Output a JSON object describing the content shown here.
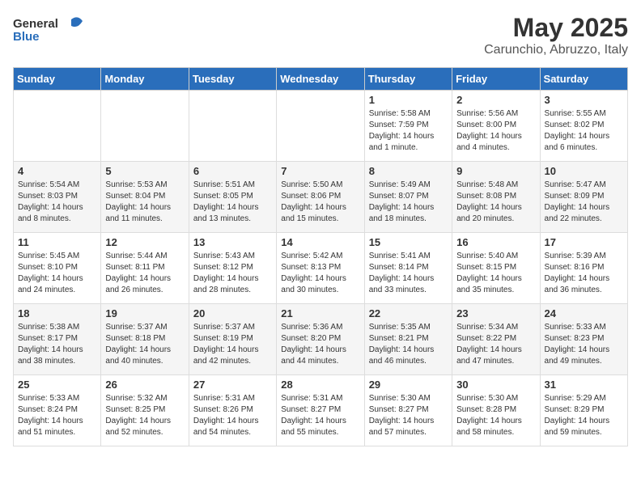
{
  "header": {
    "logo_general": "General",
    "logo_blue": "Blue",
    "month_year": "May 2025",
    "location": "Carunchio, Abruzzo, Italy"
  },
  "weekdays": [
    "Sunday",
    "Monday",
    "Tuesday",
    "Wednesday",
    "Thursday",
    "Friday",
    "Saturday"
  ],
  "weeks": [
    [
      {
        "day": "",
        "sunrise": "",
        "sunset": "",
        "daylight": ""
      },
      {
        "day": "",
        "sunrise": "",
        "sunset": "",
        "daylight": ""
      },
      {
        "day": "",
        "sunrise": "",
        "sunset": "",
        "daylight": ""
      },
      {
        "day": "",
        "sunrise": "",
        "sunset": "",
        "daylight": ""
      },
      {
        "day": "1",
        "sunrise": "Sunrise: 5:58 AM",
        "sunset": "Sunset: 7:59 PM",
        "daylight": "Daylight: 14 hours and 1 minute."
      },
      {
        "day": "2",
        "sunrise": "Sunrise: 5:56 AM",
        "sunset": "Sunset: 8:00 PM",
        "daylight": "Daylight: 14 hours and 4 minutes."
      },
      {
        "day": "3",
        "sunrise": "Sunrise: 5:55 AM",
        "sunset": "Sunset: 8:02 PM",
        "daylight": "Daylight: 14 hours and 6 minutes."
      }
    ],
    [
      {
        "day": "4",
        "sunrise": "Sunrise: 5:54 AM",
        "sunset": "Sunset: 8:03 PM",
        "daylight": "Daylight: 14 hours and 8 minutes."
      },
      {
        "day": "5",
        "sunrise": "Sunrise: 5:53 AM",
        "sunset": "Sunset: 8:04 PM",
        "daylight": "Daylight: 14 hours and 11 minutes."
      },
      {
        "day": "6",
        "sunrise": "Sunrise: 5:51 AM",
        "sunset": "Sunset: 8:05 PM",
        "daylight": "Daylight: 14 hours and 13 minutes."
      },
      {
        "day": "7",
        "sunrise": "Sunrise: 5:50 AM",
        "sunset": "Sunset: 8:06 PM",
        "daylight": "Daylight: 14 hours and 15 minutes."
      },
      {
        "day": "8",
        "sunrise": "Sunrise: 5:49 AM",
        "sunset": "Sunset: 8:07 PM",
        "daylight": "Daylight: 14 hours and 18 minutes."
      },
      {
        "day": "9",
        "sunrise": "Sunrise: 5:48 AM",
        "sunset": "Sunset: 8:08 PM",
        "daylight": "Daylight: 14 hours and 20 minutes."
      },
      {
        "day": "10",
        "sunrise": "Sunrise: 5:47 AM",
        "sunset": "Sunset: 8:09 PM",
        "daylight": "Daylight: 14 hours and 22 minutes."
      }
    ],
    [
      {
        "day": "11",
        "sunrise": "Sunrise: 5:45 AM",
        "sunset": "Sunset: 8:10 PM",
        "daylight": "Daylight: 14 hours and 24 minutes."
      },
      {
        "day": "12",
        "sunrise": "Sunrise: 5:44 AM",
        "sunset": "Sunset: 8:11 PM",
        "daylight": "Daylight: 14 hours and 26 minutes."
      },
      {
        "day": "13",
        "sunrise": "Sunrise: 5:43 AM",
        "sunset": "Sunset: 8:12 PM",
        "daylight": "Daylight: 14 hours and 28 minutes."
      },
      {
        "day": "14",
        "sunrise": "Sunrise: 5:42 AM",
        "sunset": "Sunset: 8:13 PM",
        "daylight": "Daylight: 14 hours and 30 minutes."
      },
      {
        "day": "15",
        "sunrise": "Sunrise: 5:41 AM",
        "sunset": "Sunset: 8:14 PM",
        "daylight": "Daylight: 14 hours and 33 minutes."
      },
      {
        "day": "16",
        "sunrise": "Sunrise: 5:40 AM",
        "sunset": "Sunset: 8:15 PM",
        "daylight": "Daylight: 14 hours and 35 minutes."
      },
      {
        "day": "17",
        "sunrise": "Sunrise: 5:39 AM",
        "sunset": "Sunset: 8:16 PM",
        "daylight": "Daylight: 14 hours and 36 minutes."
      }
    ],
    [
      {
        "day": "18",
        "sunrise": "Sunrise: 5:38 AM",
        "sunset": "Sunset: 8:17 PM",
        "daylight": "Daylight: 14 hours and 38 minutes."
      },
      {
        "day": "19",
        "sunrise": "Sunrise: 5:37 AM",
        "sunset": "Sunset: 8:18 PM",
        "daylight": "Daylight: 14 hours and 40 minutes."
      },
      {
        "day": "20",
        "sunrise": "Sunrise: 5:37 AM",
        "sunset": "Sunset: 8:19 PM",
        "daylight": "Daylight: 14 hours and 42 minutes."
      },
      {
        "day": "21",
        "sunrise": "Sunrise: 5:36 AM",
        "sunset": "Sunset: 8:20 PM",
        "daylight": "Daylight: 14 hours and 44 minutes."
      },
      {
        "day": "22",
        "sunrise": "Sunrise: 5:35 AM",
        "sunset": "Sunset: 8:21 PM",
        "daylight": "Daylight: 14 hours and 46 minutes."
      },
      {
        "day": "23",
        "sunrise": "Sunrise: 5:34 AM",
        "sunset": "Sunset: 8:22 PM",
        "daylight": "Daylight: 14 hours and 47 minutes."
      },
      {
        "day": "24",
        "sunrise": "Sunrise: 5:33 AM",
        "sunset": "Sunset: 8:23 PM",
        "daylight": "Daylight: 14 hours and 49 minutes."
      }
    ],
    [
      {
        "day": "25",
        "sunrise": "Sunrise: 5:33 AM",
        "sunset": "Sunset: 8:24 PM",
        "daylight": "Daylight: 14 hours and 51 minutes."
      },
      {
        "day": "26",
        "sunrise": "Sunrise: 5:32 AM",
        "sunset": "Sunset: 8:25 PM",
        "daylight": "Daylight: 14 hours and 52 minutes."
      },
      {
        "day": "27",
        "sunrise": "Sunrise: 5:31 AM",
        "sunset": "Sunset: 8:26 PM",
        "daylight": "Daylight: 14 hours and 54 minutes."
      },
      {
        "day": "28",
        "sunrise": "Sunrise: 5:31 AM",
        "sunset": "Sunset: 8:27 PM",
        "daylight": "Daylight: 14 hours and 55 minutes."
      },
      {
        "day": "29",
        "sunrise": "Sunrise: 5:30 AM",
        "sunset": "Sunset: 8:27 PM",
        "daylight": "Daylight: 14 hours and 57 minutes."
      },
      {
        "day": "30",
        "sunrise": "Sunrise: 5:30 AM",
        "sunset": "Sunset: 8:28 PM",
        "daylight": "Daylight: 14 hours and 58 minutes."
      },
      {
        "day": "31",
        "sunrise": "Sunrise: 5:29 AM",
        "sunset": "Sunset: 8:29 PM",
        "daylight": "Daylight: 14 hours and 59 minutes."
      }
    ]
  ]
}
